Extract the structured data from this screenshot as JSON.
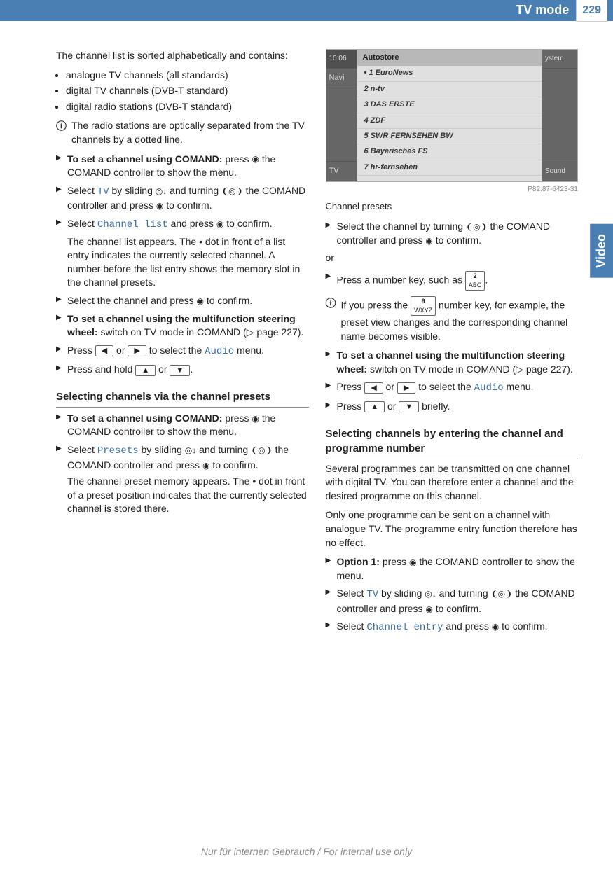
{
  "header": {
    "title": "TV mode",
    "page": "229"
  },
  "sideTab": "Video",
  "left": {
    "intro": "The channel list is sorted alphabetically and contains:",
    "bullets": [
      "analogue TV channels (all standards)",
      "digital TV channels (DVB-T standard)",
      "digital radio stations (DVB-T standard)"
    ],
    "info1": "The radio stations are optically separated from the TV channels by a dotted line.",
    "s1a": "To set a channel using COMAND:",
    "s1b": " press ",
    "s1c": " the COMAND controller to show the menu.",
    "s2a": "Select ",
    "menuTV": "TV",
    "s2b": " by sliding ",
    "s2c": " and turning ",
    "s2d": " the COMAND controller and press ",
    "s2e": " to confirm.",
    "s3a": "Select ",
    "menuChList": "Channel list",
    "s3b": " and press ",
    "s3c": " to confirm.",
    "s3desc": "The channel list appears. The  •  dot in front of a list entry indicates the currently selected channel. A number before the list entry shows the memory slot in the channel presets.",
    "s4": "Select the channel and press ",
    "s4b": " to confirm.",
    "s5a": "To set a channel using the multifunction steering wheel:",
    "s5b": " switch on TV mode in COMAND (▷ page 227).",
    "s6a": "Press ",
    "s6b": " or ",
    "s6c": " to select the ",
    "menuAudio": "Audio",
    "s6d": " menu.",
    "s7a": "Press and hold ",
    "s7b": " or ",
    "s7c": ".",
    "h2a": "Selecting channels via the channel presets",
    "s8a": "To set a channel using COMAND:",
    "s8b": " press ",
    "s8c": " the COMAND controller to show the menu.",
    "s9a": "Select ",
    "menuPresets": "Presets",
    "s9b": " by sliding ",
    "s9c": " and turning ",
    "s9d": " the COMAND controller and press ",
    "s9e": " to confirm.",
    "s9desc": "The channel preset memory appears. The  •  dot in front of a preset position indicates that the currently selected channel is stored there."
  },
  "screenshot": {
    "time": "10:06",
    "title": "Autostore",
    "navLabel": "Navi",
    "tvLabel": "TV",
    "sysLabel": "ystem",
    "soundLabel": "Sound",
    "rows": [
      "• 1  EuroNews",
      "2  n-tv",
      "3  DAS ERSTE",
      "4  ZDF",
      "5  SWR FERNSEHEN BW",
      "6  Bayerisches FS",
      "7  hr-fernsehen"
    ],
    "imgId": "P82.87-6423-31",
    "caption": "Channel presets"
  },
  "right": {
    "r1a": "Select the channel by turning ",
    "r1b": " the COMAND controller and press ",
    "r1c": " to confirm.",
    "or": "or",
    "r2a": "Press a number key, such as ",
    "key2": "2\nABC",
    "r2b": ".",
    "info2a": "If you press the ",
    "key9": "9\nWXYZ",
    "info2b": " number key, for example, the preset view changes and the corresponding channel name becomes visible.",
    "r3a": "To set a channel using the multifunction steering wheel:",
    "r3b": " switch on TV mode in COMAND (▷ page 227).",
    "r4a": "Press ",
    "r4b": " or ",
    "r4c": " to select the ",
    "r4d": " menu.",
    "r5a": "Press ",
    "r5b": " or ",
    "r5c": " briefly.",
    "h2b": "Selecting channels by entering the channel and programme number",
    "p1": "Several programmes can be transmitted on one channel with digital TV. You can therefore enter a channel and the desired programme on this channel.",
    "p2": "Only one programme can be sent on a channel with analogue TV. The programme entry function therefore has no effect.",
    "r6a": "Option 1:",
    "r6b": " press ",
    "r6c": " the COMAND controller to show the menu.",
    "r7a": "Select ",
    "r7b": " by sliding ",
    "r7c": " and turning ",
    "r7d": " the COMAND controller and press ",
    "r7e": " to confirm.",
    "r8a": "Select ",
    "menuChEntry": "Channel entry",
    "r8b": " and press ",
    "r8c": " to confirm."
  },
  "footer": "Nur für internen Gebrauch / For internal use only"
}
